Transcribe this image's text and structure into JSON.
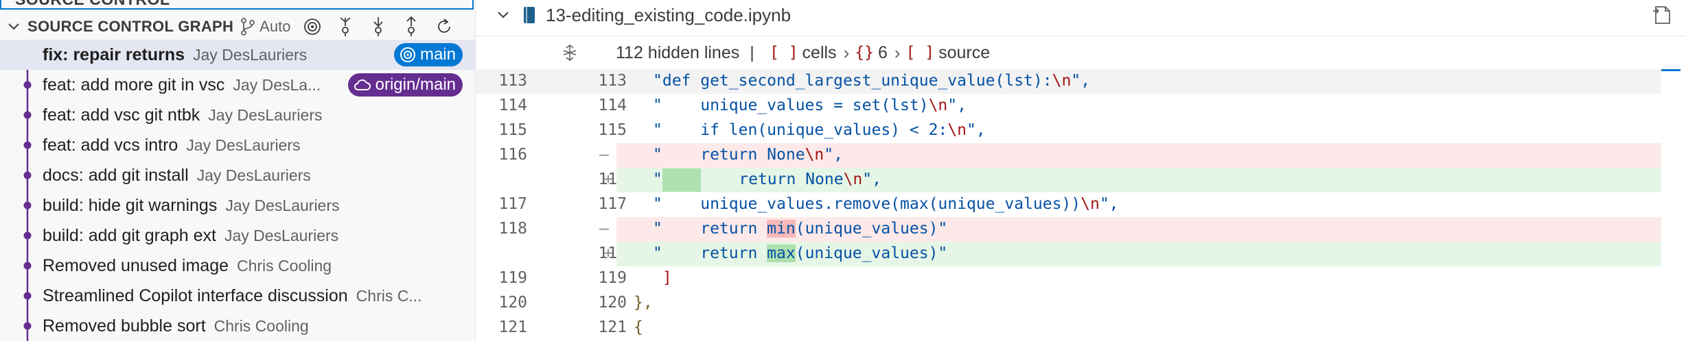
{
  "left_panel": {
    "prev_section_title": "SOURCE CONTROL",
    "graph_title": "SOURCE CONTROL GRAPH",
    "branch_selector": "Auto",
    "commits": [
      {
        "message": "fix: repair returns",
        "author": "Jay DesLauriers",
        "badge": "main",
        "badge_color": "#0078d4"
      },
      {
        "message": "feat: add more git in vsc",
        "author": "Jay DesLa...",
        "badge": "origin/main",
        "badge_color": "#652d90"
      },
      {
        "message": "feat: add vsc git ntbk",
        "author": "Jay DesLauriers"
      },
      {
        "message": "feat: add vcs intro",
        "author": "Jay DesLauriers"
      },
      {
        "message": "docs: add git install",
        "author": "Jay DesLauriers"
      },
      {
        "message": "build: hide git warnings",
        "author": "Jay DesLauriers"
      },
      {
        "message": "build: add git graph ext",
        "author": "Jay DesLauriers"
      },
      {
        "message": "Removed unused image",
        "author": "Chris Cooling"
      },
      {
        "message": "Streamlined Copilot interface discussion",
        "author": "Chris C..."
      },
      {
        "message": "Removed bubble sort",
        "author": "Chris Cooling"
      }
    ],
    "graph_color": "#652d90",
    "head_color": "#0078d4"
  },
  "editor": {
    "file_name": "13-editing_existing_code.ipynb",
    "breadcrumb": {
      "hidden_lines": "112 hidden lines",
      "separator": "|",
      "cells_label": "cells",
      "cell_index": "6",
      "source_label": "source"
    },
    "lines": [
      {
        "old": "113",
        "new": "113",
        "type": "context",
        "text": "\"def get_second_largest_unique_value(lst):",
        "esc": "\\n",
        "tail": "\","
      },
      {
        "old": "114",
        "new": "114",
        "type": "context",
        "text": "\"    unique_values = set(lst)",
        "esc": "\\n",
        "tail": "\","
      },
      {
        "old": "115",
        "new": "115",
        "type": "context",
        "text": "\"    if len(unique_values) < 2:",
        "esc": "\\n",
        "tail": "\","
      },
      {
        "old": "116",
        "new": "",
        "type": "deleted",
        "text": "\"    return None",
        "esc": "\\n",
        "tail": "\","
      },
      {
        "old": "",
        "new": "116",
        "type": "inserted",
        "text": "\"",
        "text2": "    return None",
        "esc": "\\n",
        "tail": "\","
      },
      {
        "old": "117",
        "new": "117",
        "type": "context",
        "text": "\"    unique_values.remove(max(unique_values))",
        "esc": "\\n",
        "tail": "\","
      },
      {
        "old": "118",
        "new": "",
        "type": "deleted",
        "text": "\"    return ",
        "hl": "min",
        "after": "(unique_values)\""
      },
      {
        "old": "",
        "new": "118",
        "type": "inserted",
        "text": "\"    return ",
        "hl": "max",
        "after": "(unique_values)\""
      },
      {
        "old": "119",
        "new": "119",
        "type": "context",
        "text": " ]"
      },
      {
        "old": "120",
        "new": "120",
        "type": "context",
        "text": "},"
      },
      {
        "old": "121",
        "new": "121",
        "type": "context",
        "text": "{"
      }
    ],
    "deleted_marker": "—",
    "inserted_marker": "+"
  }
}
